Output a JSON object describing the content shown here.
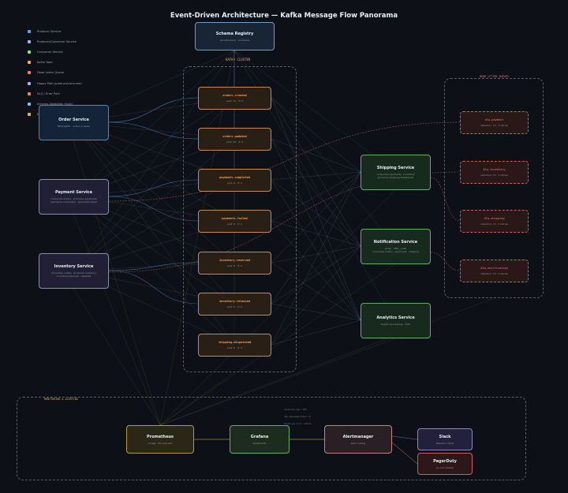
{
  "title": "Event-Driven Architecture — Kafka Message Flow Panorama",
  "legend": [
    {
      "label": "Producer Service",
      "color": "#58a6ff"
    },
    {
      "label": "Producer/Consumer Service",
      "color": "#a5b4fc"
    },
    {
      "label": "Consumer Service",
      "color": "#7ee787"
    },
    {
      "label": "Kafka Topic",
      "color": "#ffa657"
    },
    {
      "label": "Dead Letter Queue",
      "color": "#ff7b72"
    },
    {
      "label": "Happy Path (produce/consume)",
      "color": "#a5b4fc"
    },
    {
      "label": "DLQ / Error Path",
      "color": "#ff7b72"
    },
    {
      "label": "Schema Validation (sync)",
      "color": "#79c0ff"
    },
    {
      "label": "Metric Scrape",
      "color": "#e3b341"
    }
  ],
  "schema_registry": {
    "title": "Schema Registry",
    "subtitle": "Avro/Protobuf · Confluent"
  },
  "clusters": {
    "kafka": "KAFKA CLUSTER",
    "dlq": "DEAD LETTER QUEUES",
    "monitoring": "MONITORING & ALERTING"
  },
  "services": {
    "order": {
      "title": "Order Service",
      "subtitle": "REST/gRPC · orders.created"
    },
    "payment": {
      "title": "Payment Service",
      "subtitle": "consumes orders · produces payments\npayments.completed · payments.failed"
    },
    "inventory": {
      "title": "Inventory Service",
      "subtitle": "consumes orders · produces inventory\ninventory.reserved · released"
    },
    "shipping": {
      "title": "Shipping Service",
      "subtitle": "consumes payments · inventory\nproduces shipping.dispatched"
    },
    "notification": {
      "title": "Notification Service",
      "subtitle": "email · SMS · push\nconsumes orders · payments · shipping"
    },
    "analytics": {
      "title": "Analytics Service",
      "subtitle": "stream processing · Flink"
    }
  },
  "topics": [
    {
      "name": "orders.created",
      "sub": "part: 12 · rf: 3"
    },
    {
      "name": "orders.updated",
      "sub": "part: 12 · rf: 3"
    },
    {
      "name": "payments.completed",
      "sub": "part: 6 · rf: 3"
    },
    {
      "name": "payments.failed",
      "sub": "part: 6 · rf: 3"
    },
    {
      "name": "inventory.reserved",
      "sub": "part: 6 · rf: 3"
    },
    {
      "name": "inventory.released",
      "sub": "part: 6 · rf: 3"
    },
    {
      "name": "shipping.dispatched",
      "sub": "part: 6 · rf: 3"
    }
  ],
  "dlqs": [
    {
      "name": "dlq.payment",
      "sub": "retention: 7d · 3 retries"
    },
    {
      "name": "dlq.inventory",
      "sub": "retention: 7d · 3 retries"
    },
    {
      "name": "dlq.shipping",
      "sub": "retention: 7d · 3 retries"
    },
    {
      "name": "dlq.notification",
      "sub": "retention: 7d · 3 retries"
    }
  ],
  "monitoring": {
    "prometheus": {
      "title": "Prometheus",
      "subtitle": "scrape: 15s intervals"
    },
    "grafana": {
      "title": "Grafana",
      "subtitle": "dashboards"
    },
    "alertmanager": {
      "title": "Alertmanager",
      "subtitle": "alert routing"
    },
    "slack": {
      "title": "Slack",
      "subtitle": "#alerts-critical"
    },
    "pagerduty": {
      "title": "PagerDuty",
      "subtitle": "on-call rotation"
    },
    "notes": [
      "consumer_lag > 10k",
      "dlq_messages_total > 0",
      "broker_up == 0 · critical"
    ]
  },
  "colors": {
    "producer": "#58a6ff",
    "prodcons": "#a5b4fc",
    "consumer": "#7ee787",
    "topic": "#ffa657",
    "dlq": "#ff7b72",
    "schema": "#79c0ff",
    "metric": "#e3b341"
  }
}
